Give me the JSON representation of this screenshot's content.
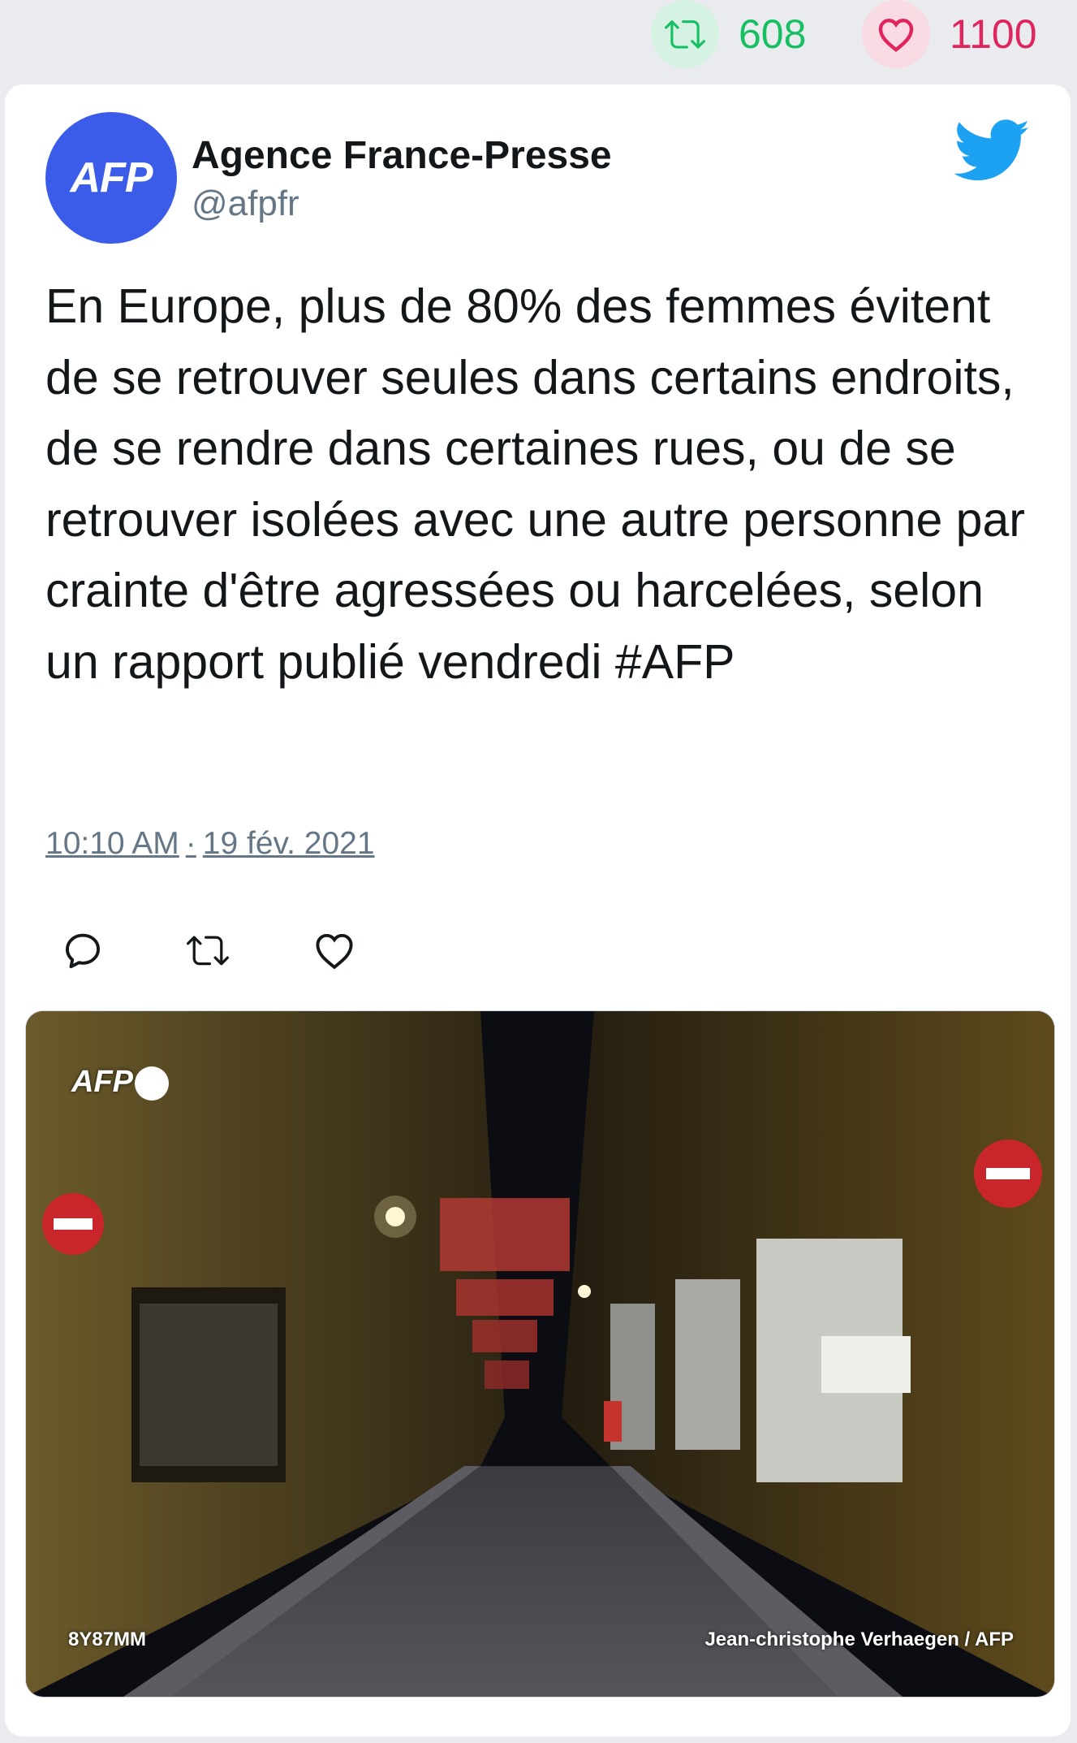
{
  "stats": {
    "retweets": "608",
    "likes": "1100",
    "retweet_icon": "retweet-icon",
    "like_icon": "heart-icon",
    "retweet_color": "#17bf63",
    "like_color": "#e0245e"
  },
  "tweet": {
    "author_name": "Agence France-Presse",
    "author_handle": "@afpfr",
    "avatar_text": "AFP",
    "text": "En Europe, plus de 80% des femmes évitent de se retrouver seules dans certains endroits, de se rendre dans certaines rues, ou de se retrouver isolées avec une autre personne par crainte d'être agressées ou harcelées, selon un rapport publié vendredi #AFP",
    "time": "10:10 AM",
    "date": "19 fév. 2021",
    "separator": "·",
    "brand_color": "#1da1f2"
  },
  "actions": [
    "reply-icon",
    "retweet-icon",
    "heart-icon"
  ],
  "media": {
    "watermark": "AFP",
    "photo_id": "8Y87MM",
    "credit": "Jean-christophe Verhaegen / AFP"
  }
}
